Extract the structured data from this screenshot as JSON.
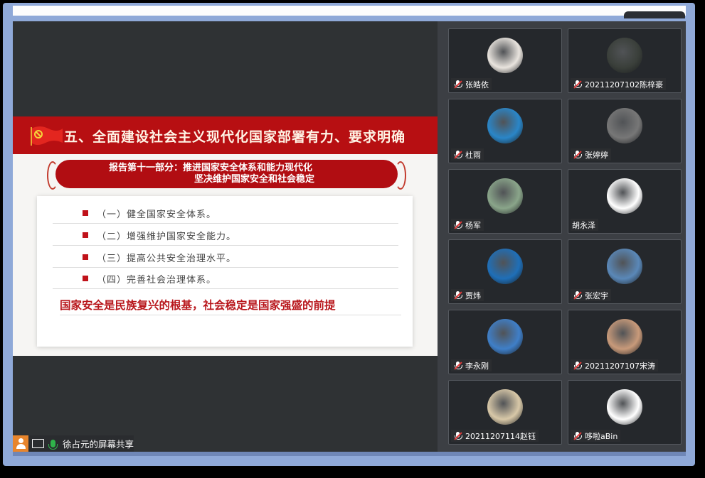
{
  "slide": {
    "title": "五、全面建设社会主义现代化国家部署有力、要求明确",
    "banner_line1": "报告第十一部分：推进国家安全体系和能力现代化",
    "banner_line2": "坚决维护国家安全和社会稳定",
    "items": [
      "（一）健全国家安全体系。",
      "（二）增强维护国家安全能力。",
      "（三）提高公共安全治理水平。",
      "（四）完善社会治理体系。"
    ],
    "quote": "国家安全是民族复兴的根基，社会稳定是国家强盛的前提"
  },
  "share_bar": {
    "label": "徐占元的屏幕共享"
  },
  "participants": [
    {
      "name": "张皓依",
      "muted": true,
      "avatar": "cat-avatar",
      "color": "#e9e4de"
    },
    {
      "name": "20211207102陈梓豪",
      "muted": true,
      "avatar": "car-avatar",
      "color": "#3a3f3a"
    },
    {
      "name": "杜雨",
      "muted": true,
      "avatar": "sky-avatar",
      "color": "#2a86c8"
    },
    {
      "name": "张婷婷",
      "muted": true,
      "avatar": "people-avatar",
      "color": "#777"
    },
    {
      "name": "杨军",
      "muted": true,
      "avatar": "tree-avatar",
      "color": "#8aa58a"
    },
    {
      "name": "胡永泽",
      "muted": false,
      "avatar": "cartoon-avatar",
      "color": "#ffffff"
    },
    {
      "name": "贾炜",
      "muted": true,
      "avatar": "jumpman-avatar",
      "color": "#1f6fb8"
    },
    {
      "name": "张宏宇",
      "muted": true,
      "avatar": "dog-avatar",
      "color": "#5a88b8"
    },
    {
      "name": "李永刚",
      "muted": true,
      "avatar": "palace-avatar",
      "color": "#3f7fc8"
    },
    {
      "name": "20211207107宋涛",
      "muted": true,
      "avatar": "child-avatar",
      "color": "#c89a7a"
    },
    {
      "name": "20211207114赵钰",
      "muted": true,
      "avatar": "toy-avatar",
      "color": "#d8c8a8"
    },
    {
      "name": "哆啦aBin",
      "muted": true,
      "avatar": "doraemon-avatar",
      "color": "#ffffff"
    }
  ]
}
